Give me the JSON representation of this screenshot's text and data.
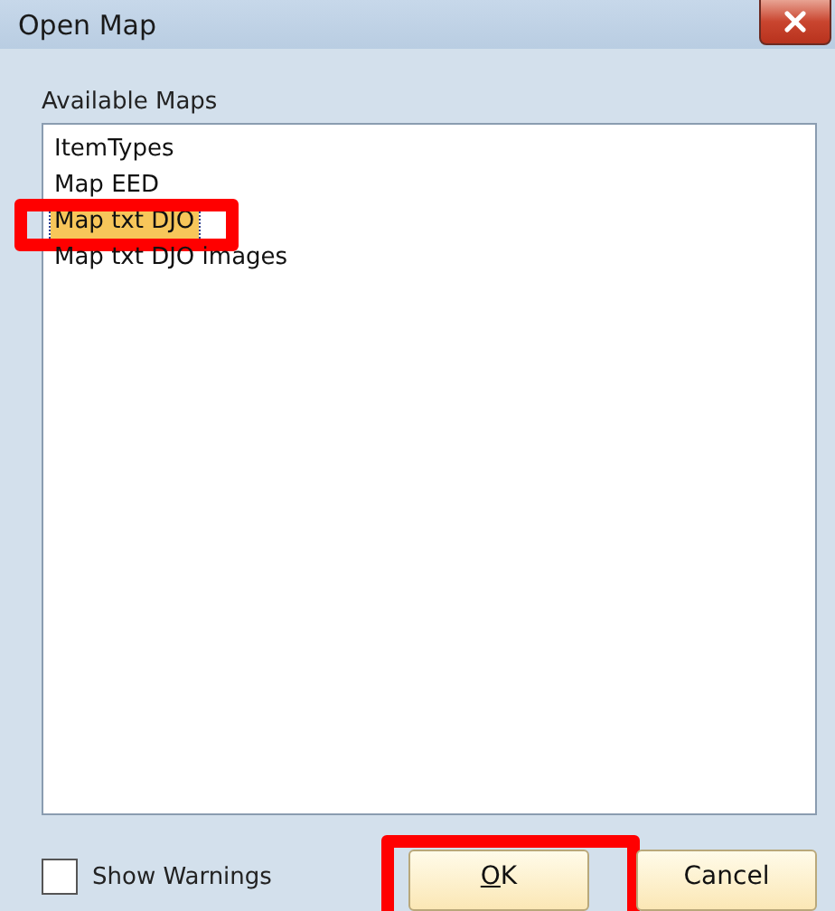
{
  "window": {
    "title": "Open Map"
  },
  "list": {
    "label": "Available Maps",
    "items": [
      {
        "label": "ItemTypes",
        "selected": false,
        "annotated": false
      },
      {
        "label": "Map EED",
        "selected": false,
        "annotated": false
      },
      {
        "label": "Map txt DJO",
        "selected": true,
        "annotated": true
      },
      {
        "label": "Map txt DJO images",
        "selected": false,
        "annotated": false
      }
    ]
  },
  "show_warnings": {
    "label": "Show Warnings",
    "checked": false
  },
  "buttons": [
    {
      "label": "OK",
      "kind": "ok",
      "annotated": true
    },
    {
      "label": "Cancel",
      "kind": "cancel",
      "annotated": false
    }
  ]
}
